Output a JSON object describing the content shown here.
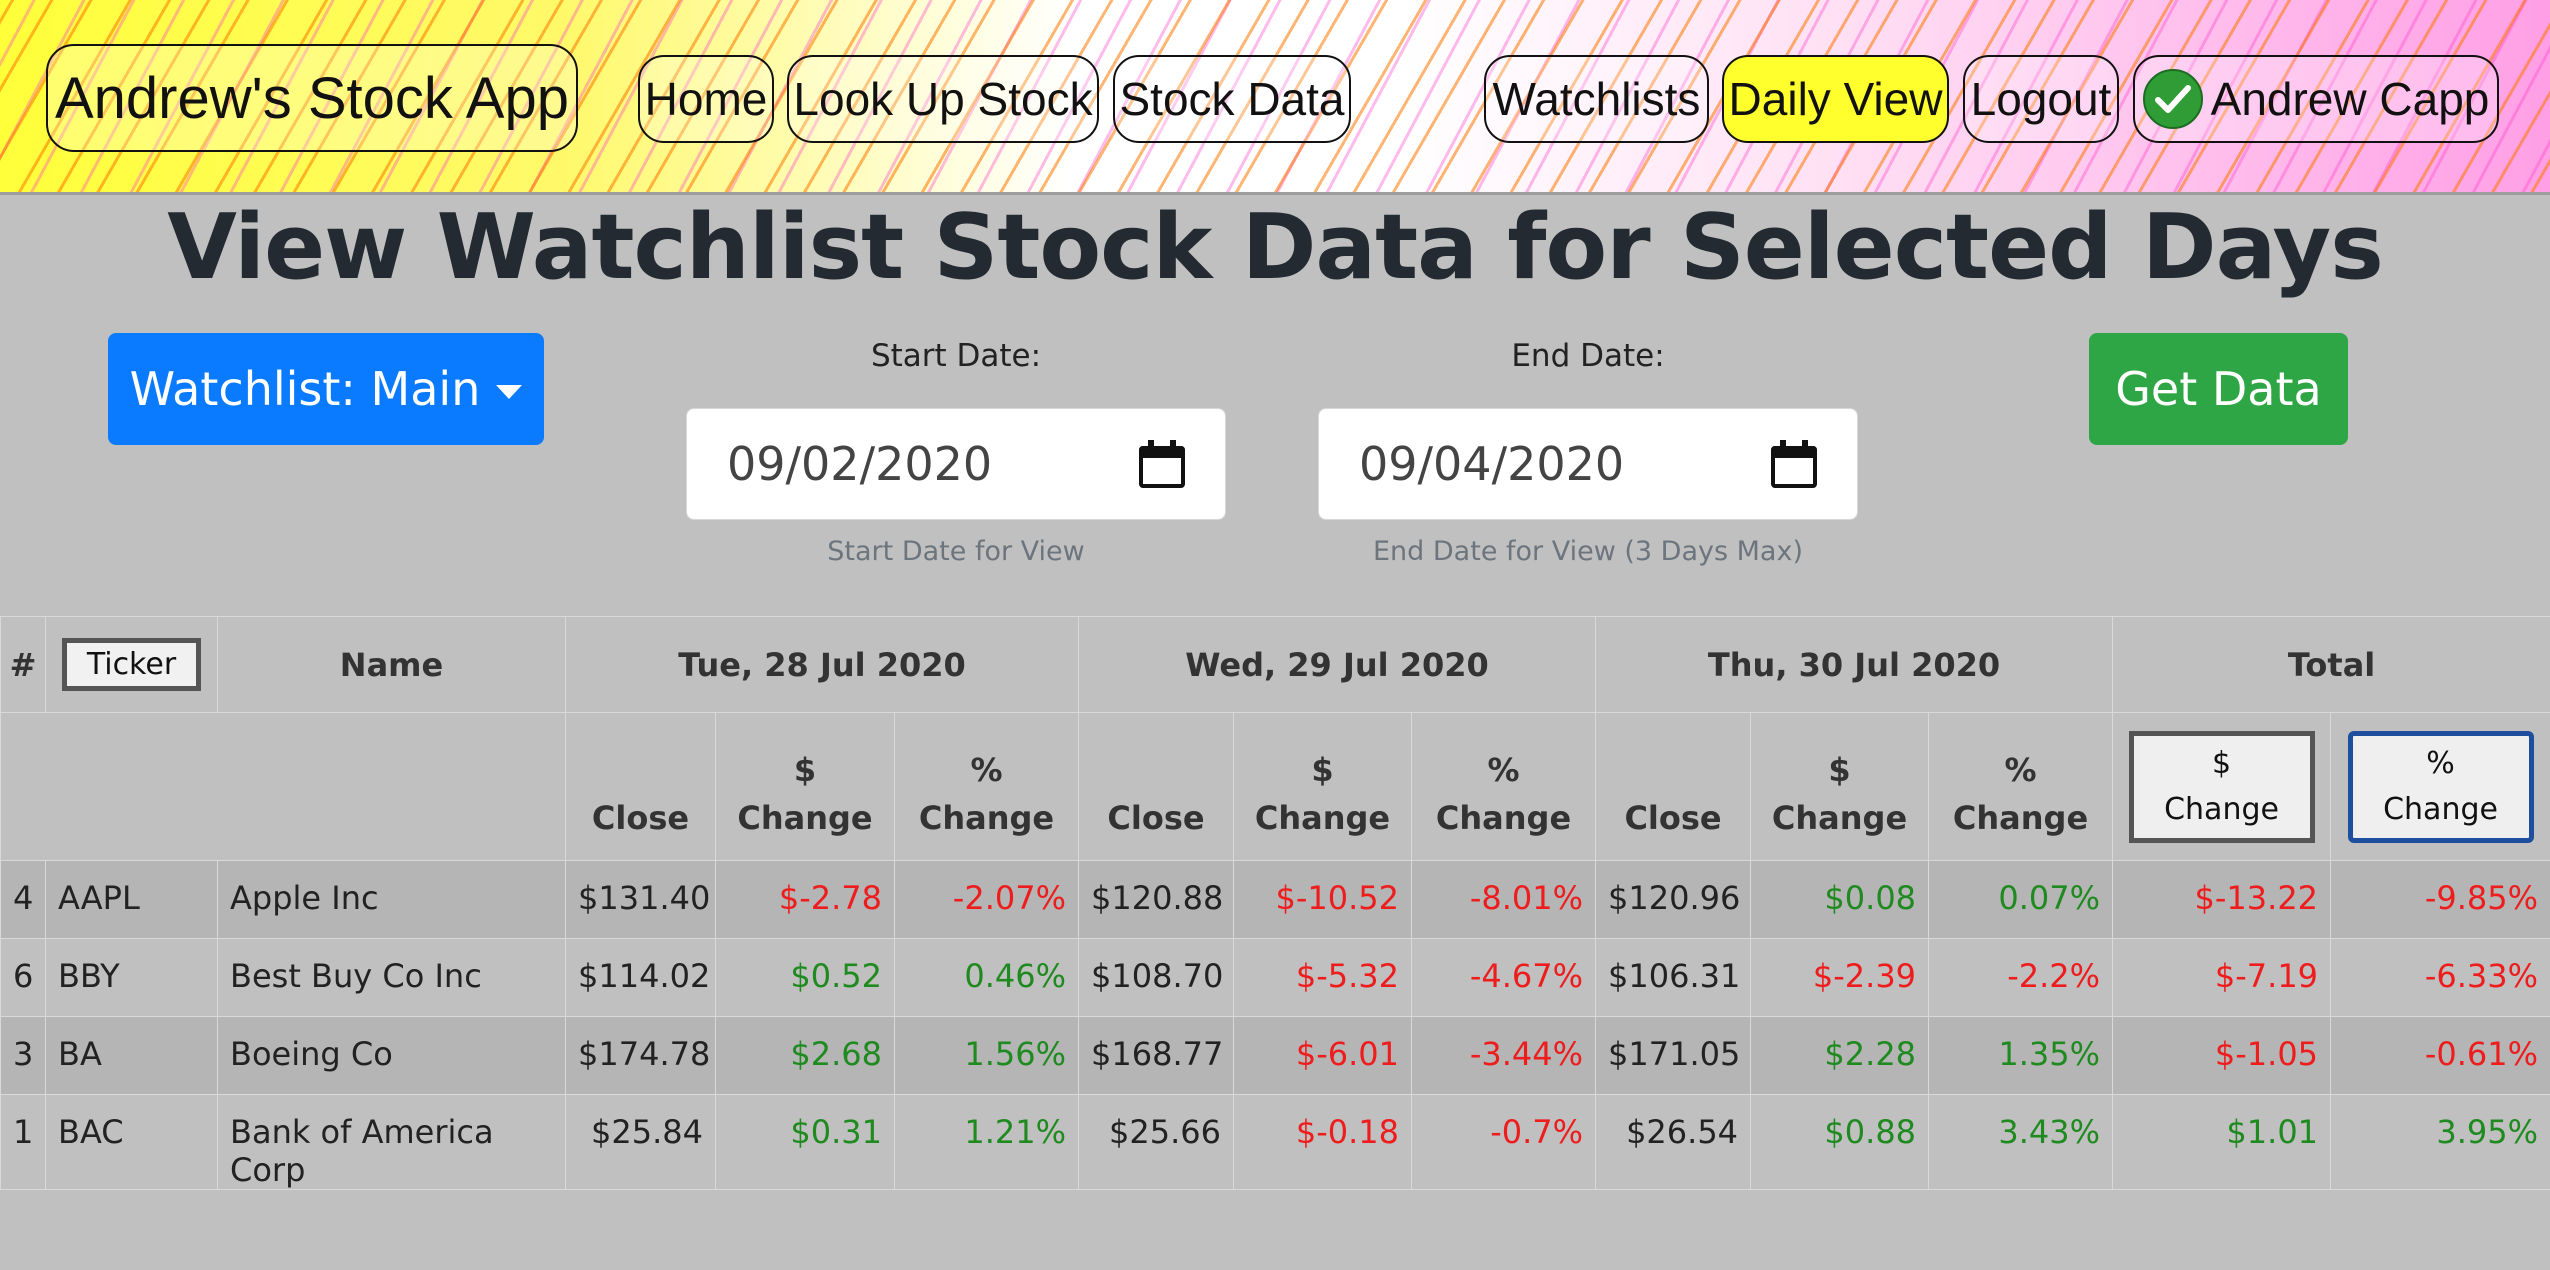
{
  "nav": {
    "brand": "Andrew's Stock App",
    "home": "Home",
    "lookup": "Look Up Stock",
    "stock_data": "Stock Data",
    "watchlists": "Watchlists",
    "daily_view": "Daily View",
    "logout": "Logout",
    "user": "Andrew Capp"
  },
  "colors": {
    "primary": "#0a7bff",
    "success": "#2fa645",
    "active_nav": "#ffff2e",
    "negative": "#ee1c1c",
    "positive": "#1f8a1f"
  },
  "page": {
    "title": "View Watchlist Stock Data for Selected Days"
  },
  "controls": {
    "watchlist_button": "Watchlist: Main",
    "start_label": "Start Date:",
    "start_value": "09/02/2020",
    "start_help": "Start Date for View",
    "end_label": "End Date:",
    "end_value": "09/04/2020",
    "end_help": "End Date for View (3 Days Max)",
    "get_data": "Get Data"
  },
  "table": {
    "head": {
      "num": "#",
      "ticker": "Ticker",
      "name": "Name",
      "day1": "Tue, 28 Jul 2020",
      "day2": "Wed, 29 Jul 2020",
      "day3": "Thu, 30 Jul 2020",
      "total": "Total"
    },
    "sub": {
      "close": "Close",
      "dollar_1": "$",
      "pct_1": "%",
      "change": "Change"
    },
    "rows": [
      {
        "num": "4",
        "ticker": "AAPL",
        "name": "Apple Inc",
        "d1": [
          "$131.40",
          "$-2.78",
          "-2.07%"
        ],
        "d2": [
          "$120.88",
          "$-10.52",
          "-8.01%"
        ],
        "d3": [
          "$120.96",
          "$0.08",
          "0.07%"
        ],
        "tot": [
          "$-13.22",
          "-9.85%"
        ]
      },
      {
        "num": "6",
        "ticker": "BBY",
        "name": "Best Buy Co Inc",
        "d1": [
          "$114.02",
          "$0.52",
          "0.46%"
        ],
        "d2": [
          "$108.70",
          "$-5.32",
          "-4.67%"
        ],
        "d3": [
          "$106.31",
          "$-2.39",
          "-2.2%"
        ],
        "tot": [
          "$-7.19",
          "-6.33%"
        ]
      },
      {
        "num": "3",
        "ticker": "BA",
        "name": "Boeing Co",
        "d1": [
          "$174.78",
          "$2.68",
          "1.56%"
        ],
        "d2": [
          "$168.77",
          "$-6.01",
          "-3.44%"
        ],
        "d3": [
          "$171.05",
          "$2.28",
          "1.35%"
        ],
        "tot": [
          "$-1.05",
          "-0.61%"
        ]
      },
      {
        "num": "1",
        "ticker": "BAC",
        "name": "Bank of America Corp",
        "d1": [
          "$25.84",
          "$0.31",
          "1.21%"
        ],
        "d2": [
          "$25.66",
          "$-0.18",
          "-0.7%"
        ],
        "d3": [
          "$26.54",
          "$0.88",
          "3.43%"
        ],
        "tot": [
          "$1.01",
          "3.95%"
        ]
      }
    ]
  }
}
